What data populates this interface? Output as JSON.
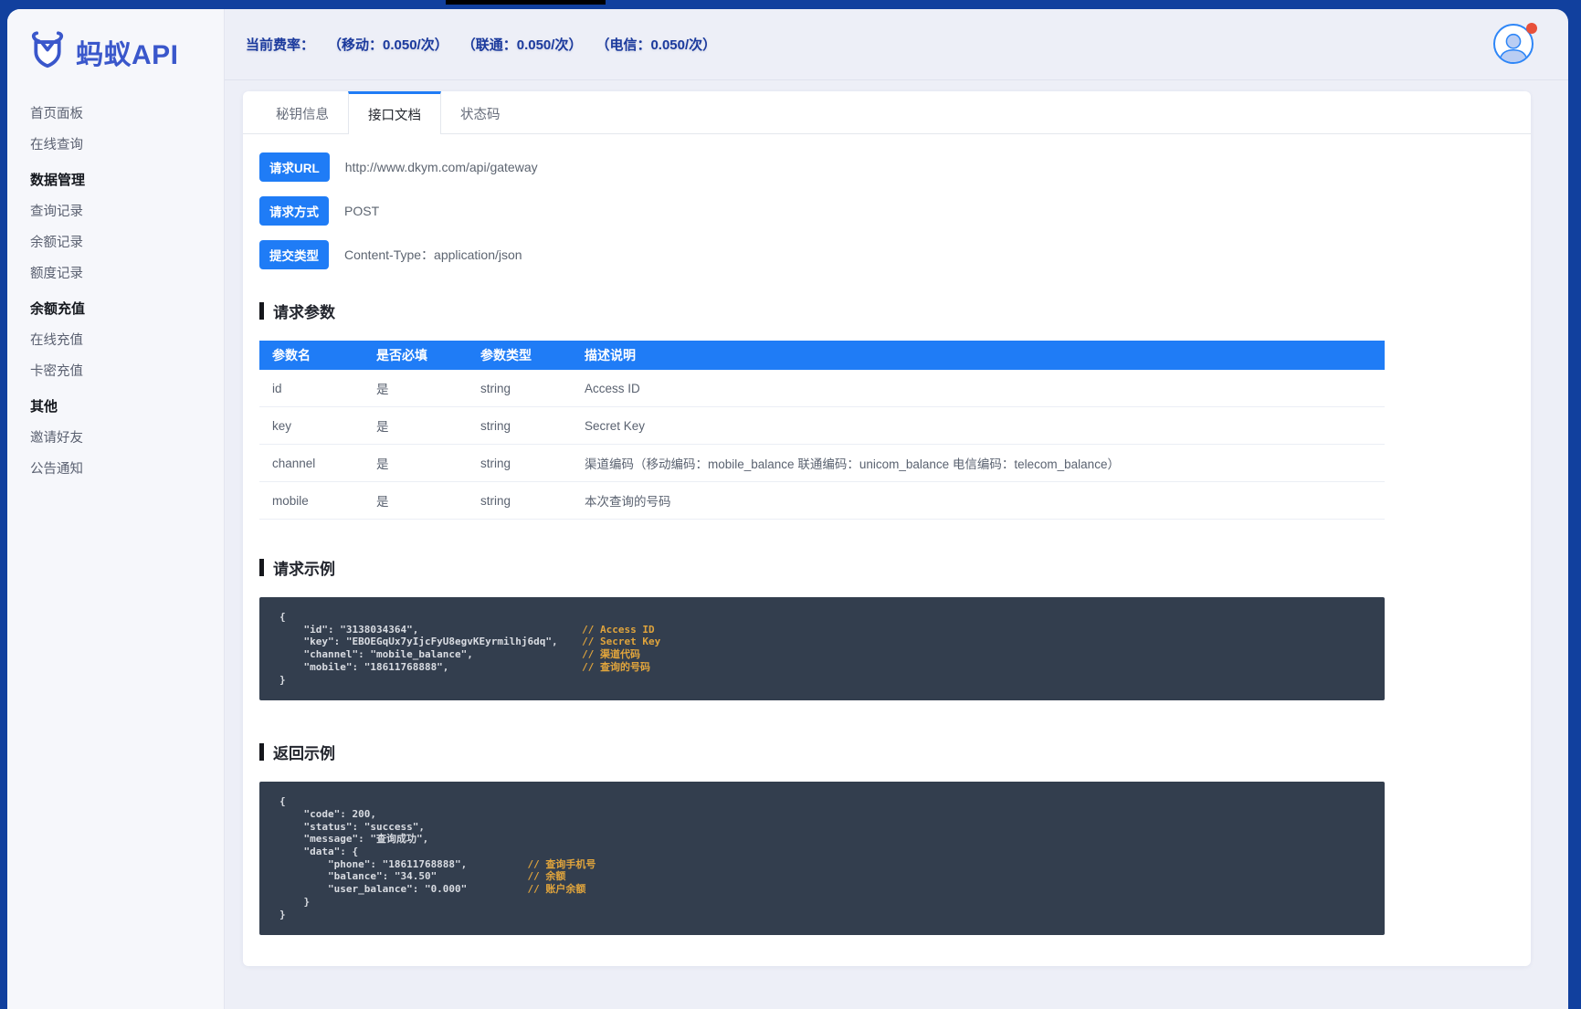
{
  "sidebar": {
    "logo_text": "蚂蚁API",
    "entries": [
      {
        "label": "首页面板"
      },
      {
        "label": "在线查询"
      },
      {
        "label": "数据管理"
      },
      {
        "label": "查询记录"
      },
      {
        "label": "余额记录"
      },
      {
        "label": "额度记录"
      },
      {
        "label": "余额充值"
      },
      {
        "label": "在线充值"
      },
      {
        "label": "卡密充值"
      },
      {
        "label": "其他"
      },
      {
        "label": "邀请好友"
      },
      {
        "label": "公告通知"
      }
    ]
  },
  "topbar": {
    "fee_label": "当前费率：",
    "rates": [
      "（移动：0.050/次）",
      "（联通：0.050/次）",
      "（电信：0.050/次）"
    ]
  },
  "tabs": [
    {
      "label": "秘钥信息"
    },
    {
      "label": "接口文档"
    },
    {
      "label": "状态码"
    }
  ],
  "api_info": [
    {
      "badge": "请求URL",
      "value": "http://www.dkym.com/api/gateway"
    },
    {
      "badge": "请求方式",
      "value": "POST"
    },
    {
      "badge": "提交类型",
      "value": "Content-Type：application/json"
    }
  ],
  "sections": {
    "params": "请求参数",
    "request_example": "请求示例",
    "response_example": "返回示例"
  },
  "params_table": {
    "headers": [
      "参数名",
      "是否必填",
      "参数类型",
      "描述说明"
    ],
    "rows": [
      {
        "name": "id",
        "required": "是",
        "type": "string",
        "desc": "Access ID"
      },
      {
        "name": "key",
        "required": "是",
        "type": "string",
        "desc": "Secret Key"
      },
      {
        "name": "channel",
        "required": "是",
        "type": "string",
        "desc": "渠道编码（移动编码：mobile_balance 联通编码：unicom_balance 电信编码：telecom_balance）"
      },
      {
        "name": "mobile",
        "required": "是",
        "type": "string",
        "desc": "本次查询的号码"
      }
    ]
  },
  "request_example": {
    "lines": [
      {
        "code": "{",
        "comment": ""
      },
      {
        "code": "    \"id\": \"3138034364\",",
        "comment": "// Access ID"
      },
      {
        "code": "    \"key\": \"EBOEGqUx7yIjcFyU8egvKEyrmilhj6dq\",",
        "comment": "// Secret Key"
      },
      {
        "code": "    \"channel\": \"mobile_balance\",",
        "comment": "// 渠道代码"
      },
      {
        "code": "    \"mobile\": \"18611768888\",",
        "comment": "// 查询的号码"
      },
      {
        "code": "}",
        "comment": ""
      }
    ]
  },
  "response_example": {
    "lines": [
      {
        "code": "{",
        "comment": ""
      },
      {
        "code": "    \"code\": 200,",
        "comment": ""
      },
      {
        "code": "    \"status\": \"success\",",
        "comment": ""
      },
      {
        "code": "    \"message\": \"查询成功\",",
        "comment": ""
      },
      {
        "code": "    \"data\": {",
        "comment": ""
      },
      {
        "code": "        \"phone\": \"18611768888\",",
        "comment": "// 查询手机号"
      },
      {
        "code": "        \"balance\": \"34.50\"",
        "comment": "// 余额"
      },
      {
        "code": "        \"user_balance\": \"0.000\"",
        "comment": "// 账户余额"
      },
      {
        "code": "    }",
        "comment": ""
      },
      {
        "code": "}",
        "comment": ""
      }
    ]
  },
  "colors": {
    "accent_blue": "#1f7cf6",
    "frame_navy": "#11409e",
    "code_bg": "#333e4e",
    "comment_orange": "#e0a43c",
    "notification_red": "#e8503a"
  }
}
